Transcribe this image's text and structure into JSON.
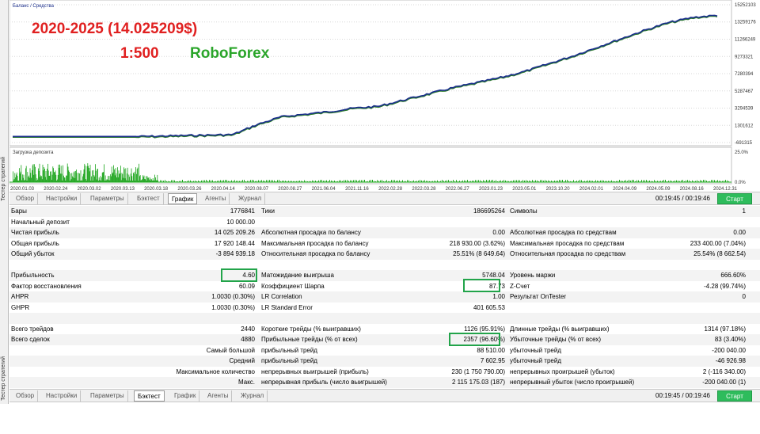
{
  "sidebar": {
    "label": "Тестер стратегий"
  },
  "chart": {
    "legend": "Баланс / Средства",
    "overlay": {
      "line1": "2020-2025  (14.025209$)",
      "line1_color": "#e02020",
      "leverage": "1:500",
      "leverage_color": "#e02020",
      "broker": "RoboForex",
      "broker_color": "#2aa52a"
    },
    "y_ticks": [
      "15252103",
      "13259176",
      "11266249",
      "9273321",
      "7280394",
      "5287467",
      "3294539",
      "1301612",
      "-691315"
    ],
    "deposit_label": "Загрузка депозита",
    "deposit_ticks": [
      "25.0%",
      "0.0%"
    ],
    "x_ticks": [
      "2020.01.03",
      "2020.02.24",
      "2020.03.02",
      "2020.03.13",
      "2020.03.18",
      "2020.03.26",
      "2020.04.14",
      "2020.08.07",
      "2020.08.27",
      "2021.06.04",
      "2021.11.16",
      "2022.02.28",
      "2022.03.28",
      "2022.06.27",
      "2023.01.23",
      "2023.05.01",
      "2023.10.20",
      "2024.02.01",
      "2024.04.09",
      "2024.05.09",
      "2024.08.16",
      "2024.12.31"
    ],
    "colors": {
      "balance": "#1a2e8c",
      "equity": "#2a7a2a",
      "grid": "#d8d8d8",
      "deposit": "#1aa41a"
    }
  },
  "chart_data": {
    "type": "line",
    "series": [
      {
        "name": "Баланс",
        "values": [
          10000,
          60000,
          120000,
          180000,
          240000,
          1400000,
          2300000,
          2600000,
          2900000,
          3300000,
          3500000,
          4200000,
          4900000,
          5600000,
          6200000,
          6800000,
          7500000,
          8400000,
          9300000,
          10300000,
          11300000,
          12300000,
          13200000,
          13800000,
          14035209
        ]
      }
    ],
    "y_ticks": [
      15252103,
      13259176,
      11266249,
      9273321,
      7280394,
      5287467,
      3294539,
      1301612,
      -691315
    ],
    "ylim": [
      -691315,
      15252103
    ]
  },
  "toolbar": {
    "tabs": [
      "Обзор",
      "Настройки",
      "Параметры",
      "Бэктест",
      "График",
      "Агенты",
      "Журнал"
    ],
    "timer": "00:19:45 / 00:19:46",
    "start": "Старт"
  },
  "stats": {
    "rows": [
      {
        "c1l": "Бары",
        "c1v": "1776841",
        "c2l": "Тики",
        "c2v": "186695264",
        "c3l": "Символы",
        "c3v": "1"
      },
      {
        "c1l": "Начальный депозит",
        "c1v": "10 000.00",
        "c2l": "",
        "c2v": "",
        "c3l": "",
        "c3v": ""
      },
      {
        "c1l": "Чистая прибыль",
        "c1v": "14 025 209.26",
        "c2l": "Абсолютная просадка по балансу",
        "c2v": "0.00",
        "c3l": "Абсолютная просадка по средствам",
        "c3v": "0.00"
      },
      {
        "c1l": "Общая прибыль",
        "c1v": "17 920 148.44",
        "c2l": "Максимальная просадка по балансу",
        "c2v": "218 930.00 (3.62%)",
        "c3l": "Максимальная просадка по средствам",
        "c3v": "233 400.00 (7.04%)"
      },
      {
        "c1l": "Общий убыток",
        "c1v": "-3 894 939.18",
        "c2l": "Относительная просадка по балансу",
        "c2v": "25.51% (8 649.64)",
        "c3l": "Относительная просадка по средствам",
        "c3v": "25.54% (8 662.54)"
      },
      {
        "c1l": "",
        "c1v": "",
        "c2l": "",
        "c2v": "",
        "c3l": "",
        "c3v": ""
      },
      {
        "c1l": "Прибыльность",
        "c1v": "4.60",
        "c2l": "Матожидание выигрыша",
        "c2v": "5748.04",
        "c3l": "Уровень маржи",
        "c3v": "666.60%"
      },
      {
        "c1l": "Фактор восстановления",
        "c1v": "60.09",
        "c2l": "Коэффициент Шарпа",
        "c2v": "87.73",
        "c3l": "Z-Счет",
        "c3v": "-4.28 (99.74%)"
      },
      {
        "c1l": "AHPR",
        "c1v": "1.0030 (0.30%)",
        "c2l": "LR Correlation",
        "c2v": "1.00",
        "c3l": "Результат OnTester",
        "c3v": "0"
      },
      {
        "c1l": "GHPR",
        "c1v": "1.0030 (0.30%)",
        "c2l": "LR Standard Error",
        "c2v": "401 605.53",
        "c3l": "",
        "c3v": ""
      },
      {
        "c1l": "",
        "c1v": "",
        "c2l": "",
        "c2v": "",
        "c3l": "",
        "c3v": ""
      },
      {
        "c1l": "Всего трейдов",
        "c1v": "2440",
        "c2l": "Короткие трейды (% выигравших)",
        "c2v": "1126 (95.91%)",
        "c3l": "Длинные трейды (% выигравших)",
        "c3v": "1314 (97.18%)"
      },
      {
        "c1l": "Всего сделок",
        "c1v": "4880",
        "c2l": "Прибыльные трейды (% от всех)",
        "c2v": "2357 (96.60%)",
        "c3l": "Убыточные трейды (% от всех)",
        "c3v": "83 (3.40%)"
      },
      {
        "c1l": "Самый большой",
        "c1v": "",
        "c2l": "прибыльный трейд",
        "c2v": "88 510.00",
        "c3l": "убыточный трейд",
        "c3v": "-200 040.00",
        "right": true
      },
      {
        "c1l": "Средний",
        "c1v": "",
        "c2l": "прибыльный трейд",
        "c2v": "7 602.95",
        "c3l": "убыточный трейд",
        "c3v": "-46 926.98",
        "right": true
      },
      {
        "c1l": "Максимальное количество",
        "c1v": "",
        "c2l": "непрерывных выигрышей (прибыль)",
        "c2v": "230 (1 750 790.00)",
        "c3l": "непрерывных проигрышей (убыток)",
        "c3v": "2 (-116 340.00)",
        "right": true
      },
      {
        "c1l": "Макс.",
        "c1v": "",
        "c2l": "непрерывная прибыль (число выигрышей)",
        "c2v": "2 115 175.03 (187)",
        "c3l": "непрерывный убыток (число проигрышей)",
        "c3v": "-200 040.00 (1)",
        "right": true
      }
    ]
  }
}
